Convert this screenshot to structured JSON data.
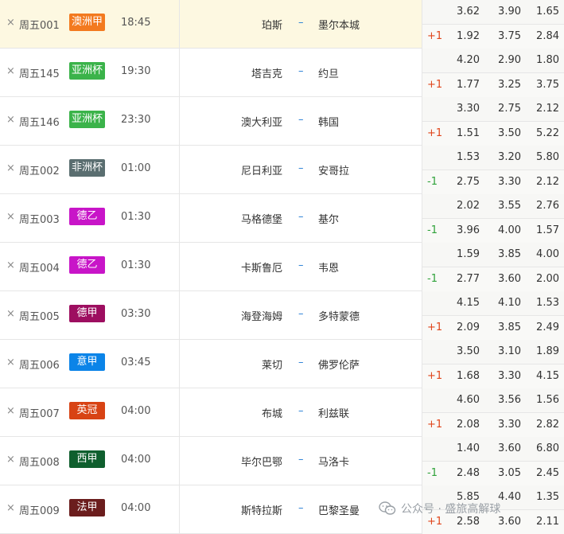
{
  "matches": [
    {
      "code": "周五001",
      "league": "澳洲甲",
      "color": "#f37a1f",
      "time": "18:45",
      "home": "珀斯",
      "vs": "–",
      "away": "墨尔本城",
      "odds1": [
        "3.62",
        "3.90",
        "1.65"
      ],
      "hc": "+1",
      "odds2": [
        "1.92",
        "3.75",
        "2.84"
      ]
    },
    {
      "code": "周五145",
      "league": "亚洲杯",
      "color": "#3bb34a",
      "time": "19:30",
      "home": "塔吉克",
      "vs": "–",
      "away": "约旦",
      "odds1": [
        "4.20",
        "2.90",
        "1.80"
      ],
      "hc": "+1",
      "odds2": [
        "1.77",
        "3.25",
        "3.75"
      ]
    },
    {
      "code": "周五146",
      "league": "亚洲杯",
      "color": "#3bb34a",
      "time": "23:30",
      "home": "澳大利亚",
      "vs": "–",
      "away": "韩国",
      "odds1": [
        "3.30",
        "2.75",
        "2.12"
      ],
      "hc": "+1",
      "odds2": [
        "1.51",
        "3.50",
        "5.22"
      ]
    },
    {
      "code": "周五002",
      "league": "非洲杯",
      "color": "#5a6e70",
      "time": "01:00",
      "home": "尼日利亚",
      "vs": "–",
      "away": "安哥拉",
      "odds1": [
        "1.53",
        "3.20",
        "5.80"
      ],
      "hc": "-1",
      "odds2": [
        "2.75",
        "3.30",
        "2.12"
      ]
    },
    {
      "code": "周五003",
      "league": "德乙",
      "color": "#c815c8",
      "time": "01:30",
      "home": "马格德堡",
      "vs": "–",
      "away": "基尔",
      "odds1": [
        "2.02",
        "3.55",
        "2.76"
      ],
      "hc": "-1",
      "odds2": [
        "3.96",
        "4.00",
        "1.57"
      ]
    },
    {
      "code": "周五004",
      "league": "德乙",
      "color": "#c815c8",
      "time": "01:30",
      "home": "卡斯鲁厄",
      "vs": "–",
      "away": "韦恩",
      "odds1": [
        "1.59",
        "3.85",
        "4.00"
      ],
      "hc": "-1",
      "odds2": [
        "2.77",
        "3.60",
        "2.00"
      ]
    },
    {
      "code": "周五005",
      "league": "德甲",
      "color": "#9d0e60",
      "time": "03:30",
      "home": "海登海姆",
      "vs": "–",
      "away": "多特蒙德",
      "odds1": [
        "4.15",
        "4.10",
        "1.53"
      ],
      "hc": "+1",
      "odds2": [
        "2.09",
        "3.85",
        "2.49"
      ]
    },
    {
      "code": "周五006",
      "league": "意甲",
      "color": "#0b84e8",
      "time": "03:45",
      "home": "莱切",
      "vs": "–",
      "away": "佛罗伦萨",
      "odds1": [
        "3.50",
        "3.10",
        "1.89"
      ],
      "hc": "+1",
      "odds2": [
        "1.68",
        "3.30",
        "4.15"
      ]
    },
    {
      "code": "周五007",
      "league": "英冠",
      "color": "#d84314",
      "time": "04:00",
      "home": "布城",
      "vs": "–",
      "away": "利兹联",
      "odds1": [
        "4.60",
        "3.56",
        "1.56"
      ],
      "hc": "+1",
      "odds2": [
        "2.08",
        "3.30",
        "2.82"
      ]
    },
    {
      "code": "周五008",
      "league": "西甲",
      "color": "#0f5f2e",
      "time": "04:00",
      "home": "毕尔巴鄂",
      "vs": "–",
      "away": "马洛卡",
      "odds1": [
        "1.40",
        "3.60",
        "6.80"
      ],
      "hc": "-1",
      "odds2": [
        "2.48",
        "3.05",
        "2.45"
      ]
    },
    {
      "code": "周五009",
      "league": "法甲",
      "color": "#6b1d1d",
      "time": "04:00",
      "home": "斯特拉斯",
      "vs": "–",
      "away": "巴黎圣曼",
      "odds1": [
        "5.85",
        "4.40",
        "1.35"
      ],
      "hc": "+1",
      "odds2": [
        "2.58",
        "3.60",
        "2.11"
      ]
    }
  ],
  "remove_glyph": "×",
  "watermark": {
    "text": "公众号 · 盛旅高解球",
    "icon": "wechat-icon"
  }
}
